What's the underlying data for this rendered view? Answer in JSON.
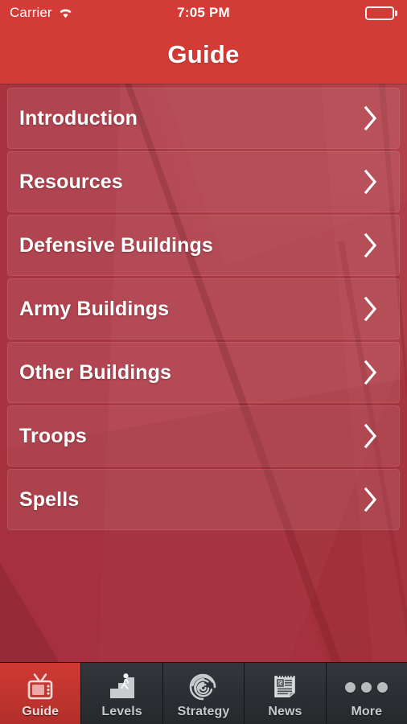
{
  "status_bar": {
    "carrier": "Carrier",
    "wifi_icon": "wifi-icon",
    "time": "7:05 PM",
    "battery_icon": "battery-full-icon"
  },
  "nav_bar": {
    "title": "Guide"
  },
  "list": {
    "rows": [
      {
        "label": "Introduction",
        "chevron": "chevron-right-icon"
      },
      {
        "label": "Resources",
        "chevron": "chevron-right-icon"
      },
      {
        "label": "Defensive Buildings",
        "chevron": "chevron-right-icon"
      },
      {
        "label": "Army Buildings",
        "chevron": "chevron-right-icon"
      },
      {
        "label": "Other Buildings",
        "chevron": "chevron-right-icon"
      },
      {
        "label": "Troops",
        "chevron": "chevron-right-icon"
      },
      {
        "label": "Spells",
        "chevron": "chevron-right-icon"
      }
    ]
  },
  "tab_bar": {
    "tabs": [
      {
        "label": "Guide",
        "icon": "television-icon",
        "active": true
      },
      {
        "label": "Levels",
        "icon": "stairs-person-icon",
        "active": false
      },
      {
        "label": "Strategy",
        "icon": "maze-spiral-icon",
        "active": false
      },
      {
        "label": "News",
        "icon": "newspaper-icon",
        "active": false
      },
      {
        "label": "More",
        "icon": "three-dots-icon",
        "active": false
      }
    ]
  },
  "colors": {
    "navbar_red": "#D23B36",
    "background_red": "#A8333D",
    "active_tab_red": "#CF3A33",
    "tabbar_dark": "#2C2E33",
    "text_white": "#FFFFFF"
  }
}
